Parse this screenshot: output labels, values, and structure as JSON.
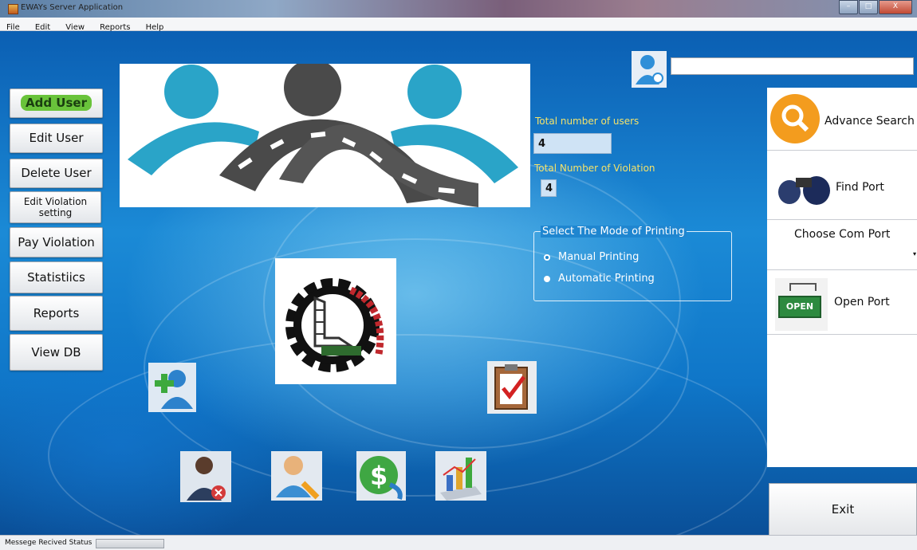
{
  "window": {
    "title": "EWAYs Server Application",
    "minimize_glyph": "–",
    "maximize_glyph": "□",
    "close_glyph": "X"
  },
  "menu": [
    "File",
    "Edit",
    "View",
    "Reports",
    "Help"
  ],
  "left_buttons": [
    {
      "label": "Add User",
      "name": "add-user-button"
    },
    {
      "label": "Edit User",
      "name": "edit-user-button"
    },
    {
      "label": "Delete User",
      "name": "delete-user-button"
    },
    {
      "label": "Edit Violation setting",
      "name": "edit-violation-setting-button"
    },
    {
      "label": "Pay Violation",
      "name": "pay-violation-button"
    },
    {
      "label": "Statistiics",
      "name": "statistics-button"
    },
    {
      "label": "Reports",
      "name": "reports-button"
    },
    {
      "label": "View DB",
      "name": "view-db-button"
    }
  ],
  "info": {
    "total_users_label": "Total number of users",
    "total_users_value": "4",
    "total_violation_label": "Total Number of Violation",
    "total_violation_value": "4"
  },
  "printing": {
    "group_title": "Select The Mode of Printing",
    "options": [
      "Manual Printing",
      "Automatic Printing"
    ],
    "selected": "Manual Printing"
  },
  "search": {
    "value": ""
  },
  "right_panel": {
    "advance_search": "Advance Search",
    "find_port": "Find Port",
    "choose_com_port": "Choose Com Port",
    "com_port_value": "",
    "open_port": "Open Port",
    "open_sign_text": "OPEN"
  },
  "exit_label": "Exit",
  "status": {
    "label": "Messege Recived Status",
    "progress": 0
  },
  "icons": {
    "search-user": "user-search-icon",
    "add-user": "add-user-icon",
    "delete-user": "delete-user-icon",
    "edit-user": "edit-user-icon",
    "pay": "dollar-refresh-icon",
    "stats": "bar-chart-icon",
    "checklist": "clipboard-check-icon"
  }
}
